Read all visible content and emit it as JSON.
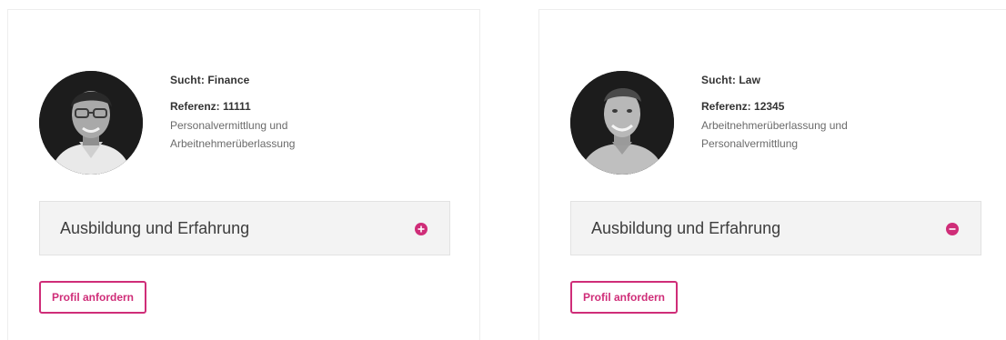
{
  "colors": {
    "accent": "#cf2d78",
    "panel": "#f3f3f3",
    "text": "#333333",
    "muted": "#6b6b6b"
  },
  "cards": [
    {
      "seeks": "Sucht: Finance",
      "reference": "Referenz: 11111",
      "description_line1": "Personalvermittlung und",
      "description_line2": "Arbeitnehmerüberlassung",
      "accordion_title": "Ausbildung und Erfahrung",
      "accordion_icon": "plus-circle-icon",
      "button_label": "Profil anfordern"
    },
    {
      "seeks": "Sucht: Law",
      "reference": "Referenz: 12345",
      "description_line1": "Arbeitnehmerüberlassung und",
      "description_line2": "Personalvermittlung",
      "accordion_title": "Ausbildung und Erfahrung",
      "accordion_icon": "minus-circle-icon",
      "button_label": "Profil anfordern"
    }
  ]
}
